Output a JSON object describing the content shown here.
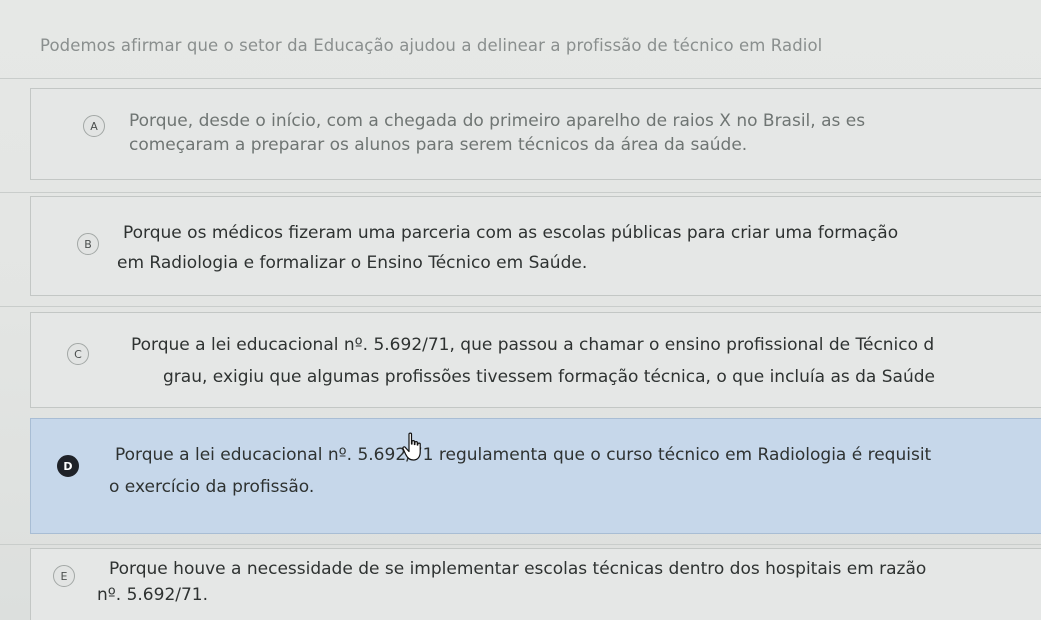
{
  "question": {
    "text": "Podemos afirmar que o setor da Educação ajudou a delinear a profissão de técnico em Radiol"
  },
  "options": [
    {
      "letter": "A",
      "line1": "Porque, desde o início, com a chegada do primeiro aparelho de raios X no Brasil, as es",
      "line2": "começaram a preparar os alunos para serem técnicos da área da saúde."
    },
    {
      "letter": "B",
      "line1": "Porque os médicos fizeram uma parceria com as escolas públicas para criar uma formação",
      "line2": "em Radiologia e formalizar o Ensino Técnico em Saúde."
    },
    {
      "letter": "C",
      "line1": "Porque a lei educacional nº. 5.692/71, que passou a chamar o ensino profissional de Técnico d",
      "line2": "grau, exigiu que algumas profissões tivessem formação técnica, o que incluía as da Saúde"
    },
    {
      "letter": "D",
      "line1": "Porque a lei educacional nº. 5.692/71 regulamenta que o curso técnico em Radiologia é requisit",
      "line2": "o exercício da profissão.",
      "selected": true
    },
    {
      "letter": "E",
      "line1": "Porque houve a necessidade de se implementar escolas técnicas dentro dos hospitais em razão",
      "line2": "nº. 5.692/71."
    }
  ],
  "cursor": {
    "icon": "hand-pointer-icon"
  },
  "colors": {
    "selected_background": "#c6d7ea",
    "selected_badge": "#1f2228",
    "background": "#e6e8e6"
  }
}
